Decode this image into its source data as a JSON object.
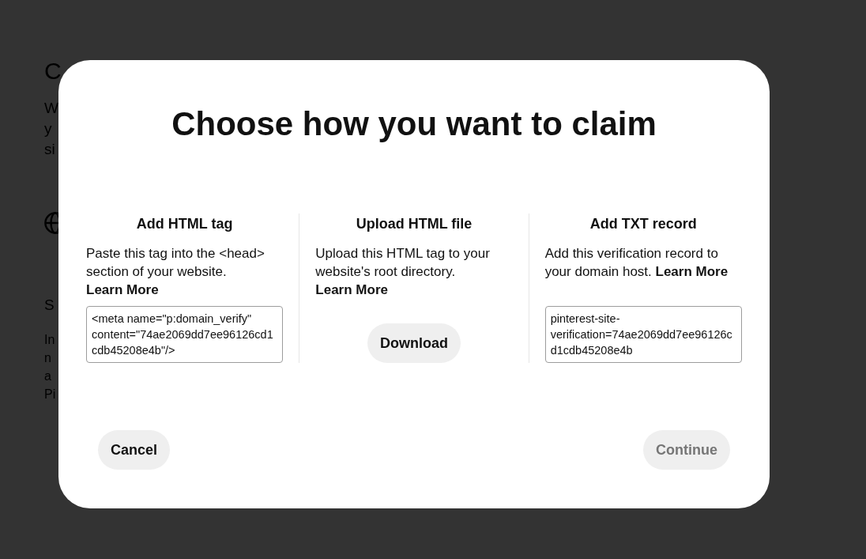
{
  "background_page": {
    "heading": "C",
    "intro_lines": [
      "W",
      "y",
      "si"
    ],
    "section_heading": "S",
    "section_lines": [
      "In",
      "n",
      "a",
      "Pi"
    ]
  },
  "dialog": {
    "title": "Choose how you want to claim",
    "options": [
      {
        "kind": "code",
        "title": "Add HTML tag",
        "description": "Paste this tag into the <head> section of your website.",
        "link": "Learn More",
        "value": "<meta name=\"p:domain_verify\" content=\"74ae2069dd7ee96126cd1cdb45208e4b\"/>"
      },
      {
        "kind": "download",
        "title": "Upload HTML file",
        "description": "Upload this HTML tag to your website's root directory.",
        "link": "Learn More",
        "button": "Download"
      },
      {
        "kind": "code",
        "title": "Add TXT record",
        "description": "Add this verification record to your domain host.",
        "link": "Learn More",
        "value": "pinterest-site-verification=74ae2069dd7ee96126cd1cdb45208e4b"
      }
    ],
    "buttons": [
      {
        "label": "Cancel",
        "disabled": false
      },
      {
        "label": "Continue",
        "disabled": true
      }
    ]
  }
}
